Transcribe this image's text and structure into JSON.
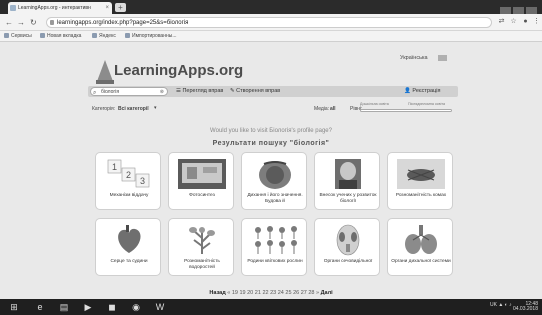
{
  "browser": {
    "tab_title": "LearningApps.org - интерактивн",
    "tab_close": "×",
    "new_tab": "+",
    "url": "learningapps.org/index.php?page=25&s=біологія",
    "bookmarks": [
      "Сервисы",
      "Новая вкладка",
      "Яндекс",
      "Импортированны..."
    ]
  },
  "header": {
    "logo_text": "LearningApps.org",
    "language": "Українська"
  },
  "navbar": {
    "search_value": "біологія",
    "browse": "Перегляд вправ",
    "create": "Створення вправ",
    "register": "Реєстрація"
  },
  "filters": {
    "category_label": "Категорія:",
    "category_value": "Всі категорії",
    "level_label": "Медіа:",
    "level_value": "all",
    "from_label": "Рівні:",
    "slider1_label": "Дошкільна освіта",
    "slider2_label": "Післядипломна освіта"
  },
  "profile_question": "Would you like to visit Біологія's profile page?",
  "results_heading": "Результати пошуку \"біологія\"",
  "cards": [
    {
      "title": "Механізм віддачу"
    },
    {
      "title": "Фотосинтез"
    },
    {
      "title": "Дихання і його значення. Будова й"
    },
    {
      "title": "Внесок учених у розвиток біології"
    },
    {
      "title": "Розноманітність комах"
    },
    {
      "title": "Серце та судини"
    },
    {
      "title": "Розноманітність водоростей"
    },
    {
      "title": "Родини квіткових рослин"
    },
    {
      "title": "Органи сечовидільної"
    },
    {
      "title": "Органи дихальної системи"
    }
  ],
  "pager": {
    "prev": "Назад",
    "pages": [
      "19",
      "19",
      "20",
      "21",
      "22",
      "23",
      "24",
      "25",
      "26",
      "27",
      "28"
    ],
    "next": "Далі"
  },
  "tray": {
    "lang": "UK",
    "time": "12:48",
    "date": "04.03.2018"
  }
}
